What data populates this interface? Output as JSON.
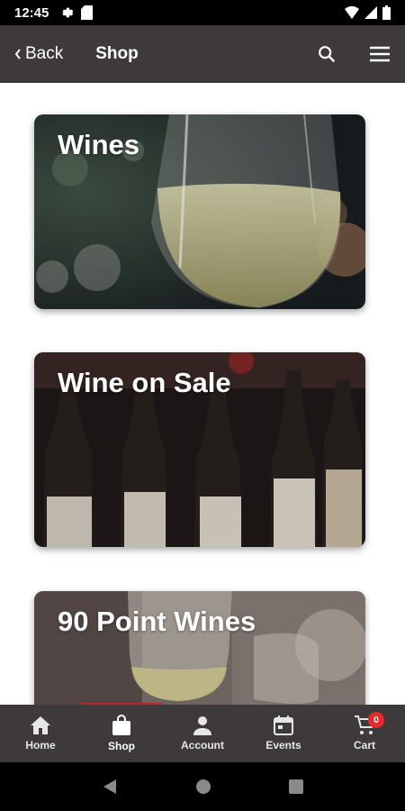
{
  "status_bar": {
    "time": "12:45"
  },
  "app_bar": {
    "back_label": "Back",
    "title": "Shop"
  },
  "cards": [
    {
      "title": "Wines"
    },
    {
      "title": "Wine on Sale"
    },
    {
      "title": "90 Point Wines"
    }
  ],
  "bottom_nav": {
    "items": [
      {
        "label": "Home",
        "icon": "home-icon"
      },
      {
        "label": "Shop",
        "icon": "shopping-bag-icon",
        "active": true
      },
      {
        "label": "Account",
        "icon": "person-icon"
      },
      {
        "label": "Events",
        "icon": "calendar-icon"
      },
      {
        "label": "Cart",
        "icon": "cart-icon",
        "badge": "0"
      }
    ]
  },
  "colors": {
    "app_bar": "#3e3a3b",
    "accent": "#c0232a",
    "badge": "#e32b2b"
  }
}
